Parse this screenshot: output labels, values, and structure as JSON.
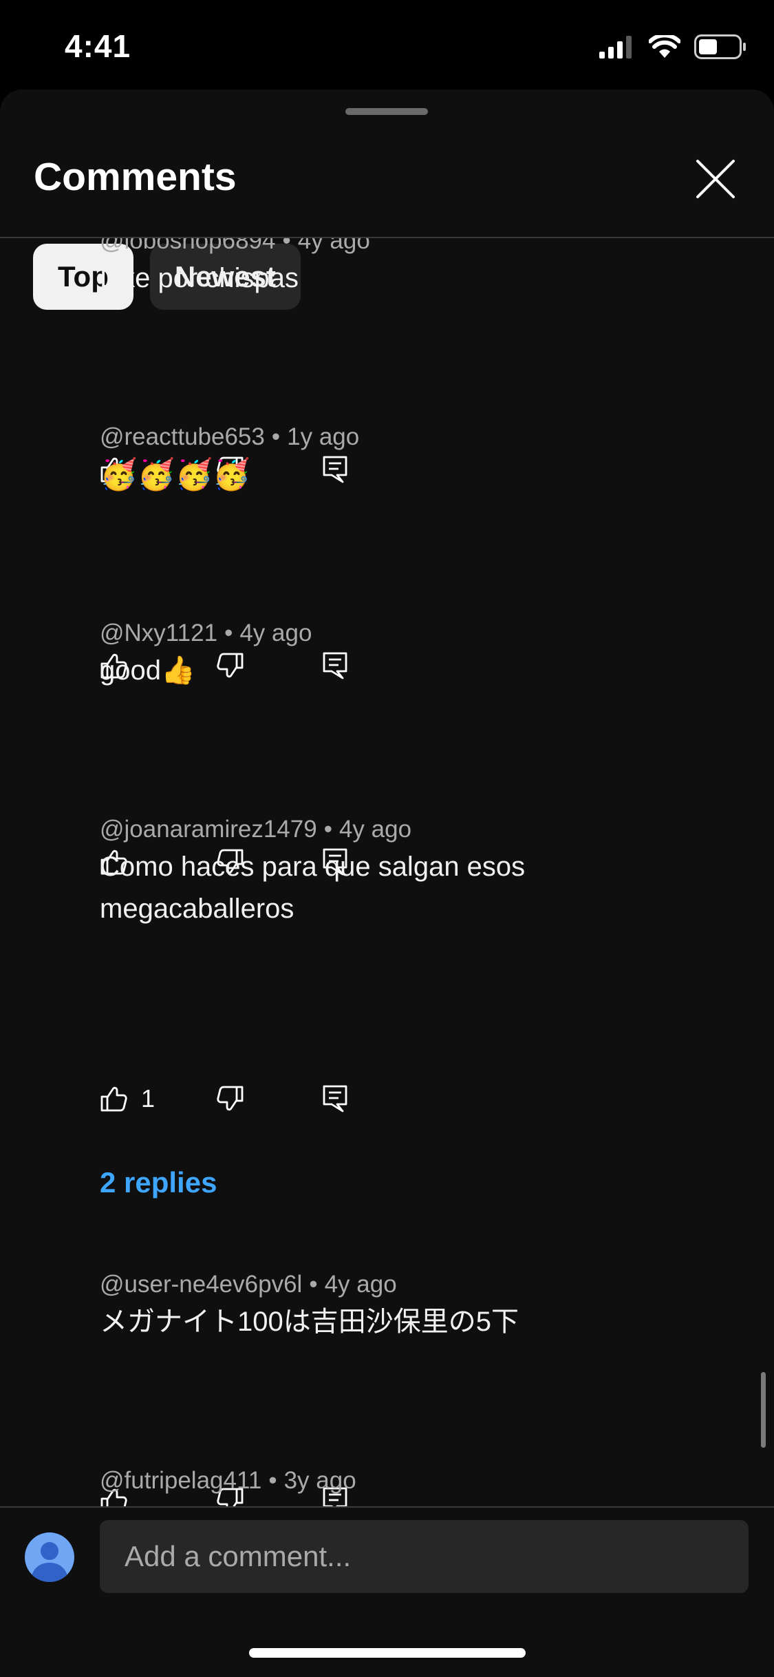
{
  "status_bar": {
    "time": "4:41",
    "icons": [
      "signal-icon",
      "wifi-icon",
      "battery-icon"
    ]
  },
  "sheet": {
    "title": "Comments",
    "close_icon": "close-icon",
    "filters": [
      {
        "label": "Top",
        "selected": true
      },
      {
        "label": "Newest",
        "selected": false
      }
    ]
  },
  "comments": [
    {
      "author": "@loboshop6894",
      "age": "4y ago",
      "text": "Like por chispas",
      "likes": ""
    },
    {
      "author": "@reacttube653",
      "age": "1y ago",
      "text": "🥳🥳🥳🥳",
      "likes": ""
    },
    {
      "author": "@Nxy1121",
      "age": "4y ago",
      "text": "good👍",
      "likes": ""
    },
    {
      "author": "@joanaramirez1479",
      "age": "4y ago",
      "text": "Como haces para que salgan esos megacaballeros",
      "likes": "1",
      "replies_label": "2 replies"
    },
    {
      "author": "@user-ne4ev6pv6l",
      "age": "4y ago",
      "text": "メガナイト100は吉田沙保里の5下",
      "likes": ""
    },
    {
      "author": "@futripelag411",
      "age": "3y ago",
      "text": "",
      "likes": ""
    }
  ],
  "composer": {
    "placeholder": "Add a comment...",
    "value": ""
  },
  "colors": {
    "background": "#0f0f0f",
    "link_blue": "#3ea6ff",
    "secondary_text": "#aaaaaa"
  }
}
